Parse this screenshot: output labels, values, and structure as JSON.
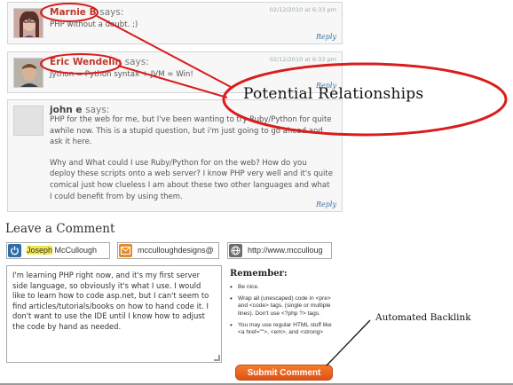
{
  "comments": [
    {
      "author": "Marnie B",
      "says": "says:",
      "date": "02/12/2010 at 6:33 pm",
      "body": "PHP without a doubt. ;)",
      "reply": "Reply"
    },
    {
      "author": "Eric Wendelin",
      "says": "says:",
      "date": "02/12/2010 at 6:33 pm",
      "body": "Jython = Python syntax + JVM = Win!",
      "reply": "Reply"
    },
    {
      "author": "john e",
      "says": "says:",
      "date": "",
      "body_p1": "PHP for the web for me, but I've been wanting to try Ruby/Python for quite awhile now. This is a stupid question, but i'm just going to go ahead and ask it here.",
      "body_p2": "Why and What could I use Ruby/Python for on the web? How do you deploy these scripts onto a web server? I know PHP very well and it's quite comical just how clueless I am about these two other languages and what I could benefit from by using them.",
      "reply": "Reply"
    }
  ],
  "form": {
    "title": "Leave a Comment",
    "name_first": "Joseph",
    "name_rest": " McCullough",
    "email": "mcculloughdesigns@",
    "url": "http://www.mcculloug",
    "comment_text": "I'm learning PHP right now, and it's my first server side language, so obviously it's what I use. I would like to learn how to code asp.net, but I can't seem to find articles/tutorials/books on how to hand code it. I don't want to use the IDE until I know how to adjust the code by hand as needed.",
    "submit_label": "Submit Comment"
  },
  "remember": {
    "title": "Remember:",
    "items": [
      "Be nice.",
      "Wrap all (unescaped) code in <pre> and <code> tags. (single or multiple lines). Don't use <?php ?> tags.",
      "You may use regular HTML stuff like <a href=\"\">, <em>, and <strong>"
    ]
  },
  "annotations": {
    "relationships": "Potential Relationships",
    "backlink": "Automated Backlink"
  },
  "colors": {
    "annotation_red": "#d91c1c",
    "author_red": "#c0392b",
    "submit_orange": "#ee6a22"
  }
}
